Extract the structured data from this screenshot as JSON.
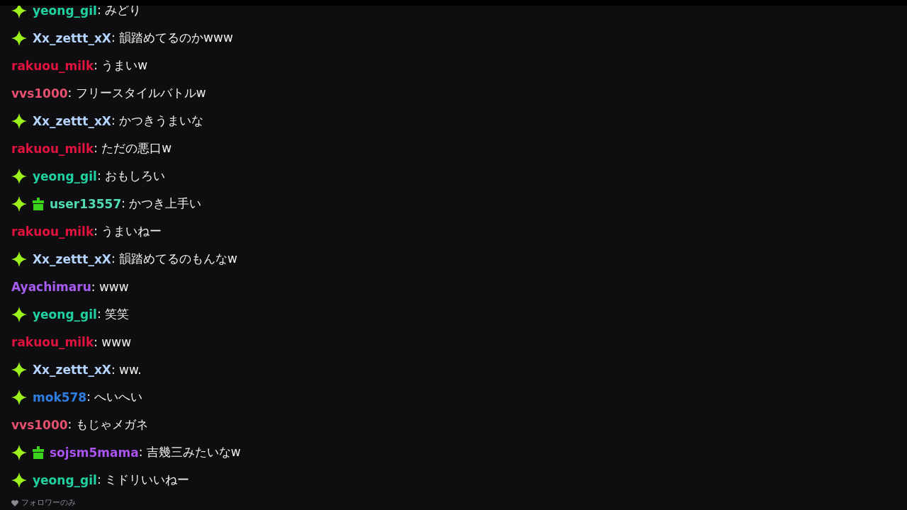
{
  "messages": [
    {
      "sparkle": true,
      "gift": false,
      "user": "yeong_gil",
      "color": "#1fd1a0",
      "text": ": みどり"
    },
    {
      "sparkle": true,
      "gift": false,
      "user": "Xx_zettt_xX",
      "color": "#b4d4ff",
      "text": ": 韻踏めてるのかwww"
    },
    {
      "sparkle": false,
      "gift": false,
      "user": "rakuou_milk",
      "color": "#e0133f",
      "text": ": うまいw"
    },
    {
      "sparkle": false,
      "gift": false,
      "user": "vvs1000",
      "color": "#e8506f",
      "text": ": フリースタイルバトルw"
    },
    {
      "sparkle": true,
      "gift": false,
      "user": "Xx_zettt_xX",
      "color": "#b4d4ff",
      "text": ": かつきうまいな"
    },
    {
      "sparkle": false,
      "gift": false,
      "user": "rakuou_milk",
      "color": "#e0133f",
      "text": ": ただの悪口w"
    },
    {
      "sparkle": true,
      "gift": false,
      "user": "yeong_gil",
      "color": "#1fd1a0",
      "text": ": おもしろい"
    },
    {
      "sparkle": true,
      "gift": true,
      "user": "user13557",
      "color": "#4fdcb4",
      "text": ": かつき上手い"
    },
    {
      "sparkle": false,
      "gift": false,
      "user": "rakuou_milk",
      "color": "#e0133f",
      "text": ": うまいねー"
    },
    {
      "sparkle": true,
      "gift": false,
      "user": "Xx_zettt_xX",
      "color": "#b4d4ff",
      "text": ": 韻踏めてるのもんなw"
    },
    {
      "sparkle": false,
      "gift": false,
      "user": "Ayachimaru",
      "color": "#a55cf0",
      "text": ": www"
    },
    {
      "sparkle": true,
      "gift": false,
      "user": "yeong_gil",
      "color": "#1fd1a0",
      "text": ": 笑笑"
    },
    {
      "sparkle": false,
      "gift": false,
      "user": "rakuou_milk",
      "color": "#e0133f",
      "text": ": www"
    },
    {
      "sparkle": true,
      "gift": false,
      "user": "Xx_zettt_xX",
      "color": "#b4d4ff",
      "text": ": ww."
    },
    {
      "sparkle": true,
      "gift": false,
      "user": "mok578",
      "color": "#2e7de0",
      "text": ": へいへい"
    },
    {
      "sparkle": false,
      "gift": false,
      "user": "vvs1000",
      "color": "#e8506f",
      "text": ": もじゃメガネ"
    },
    {
      "sparkle": true,
      "gift": true,
      "user": "sojsm5mama",
      "color": "#a953f0",
      "text": ": 吉幾三みたいなw"
    },
    {
      "sparkle": true,
      "gift": false,
      "user": "yeong_gil",
      "color": "#1fd1a0",
      "text": ": ミドリいいねー"
    }
  ],
  "footer": {
    "text": "フォロワーのみ"
  }
}
